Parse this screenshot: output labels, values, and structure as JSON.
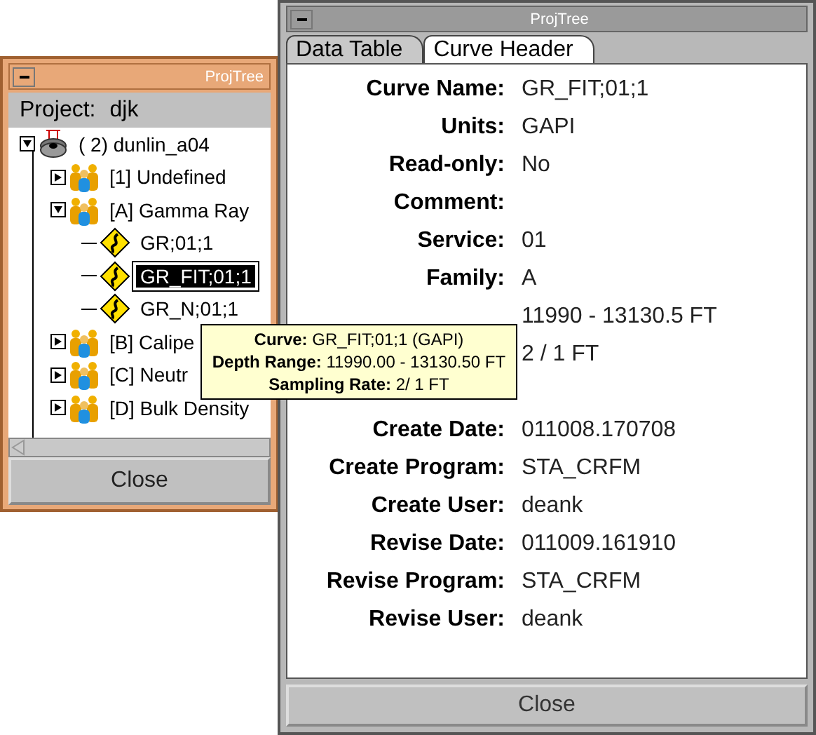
{
  "back_window": {
    "title": "ProjTree",
    "project_label": "Project:",
    "project": "djk",
    "tree": [
      {
        "kind": "well",
        "label": "(   2) dunlin_a04",
        "expanded": true,
        "children": [
          {
            "kind": "group",
            "label": "[1] Undefined",
            "expanded": false
          },
          {
            "kind": "group",
            "label": "[A] Gamma Ray",
            "expanded": true,
            "children": [
              {
                "kind": "curve",
                "label": "GR;01;1",
                "selected": false
              },
              {
                "kind": "curve",
                "label": "GR_FIT;01;1",
                "selected": true
              },
              {
                "kind": "curve",
                "label": "GR_N;01;1",
                "selected": false
              }
            ]
          },
          {
            "kind": "group",
            "label": "[B] Calipe",
            "expanded": false
          },
          {
            "kind": "group",
            "label": "[C] Neutr",
            "expanded": false
          },
          {
            "kind": "group",
            "label": "[D] Bulk Density",
            "expanded": false
          }
        ]
      }
    ],
    "close_button": "Close"
  },
  "front_window": {
    "title": "ProjTree",
    "tabs": [
      {
        "label": "Data Table",
        "selected": false
      },
      {
        "label": "Curve Header",
        "selected": true
      }
    ],
    "fields": [
      {
        "label": "Curve Name:",
        "value": "GR_FIT;01;1"
      },
      {
        "label": "Units:",
        "value": "GAPI"
      },
      {
        "label": "Read-only:",
        "value": "No"
      },
      {
        "label": "Comment:"
      },
      {
        "label": "Service:",
        "value": "01"
      },
      {
        "label": "Family:",
        "value": "A"
      },
      {
        "value": "11990 - 13130.5 FT"
      },
      {
        "value": "2 / 1 FT"
      },
      {
        "label": "Create Date:",
        "value": "011008.170708"
      },
      {
        "label": "Create Program:",
        "value": "STA_CRFM"
      },
      {
        "label": "Create User:",
        "value": "deank"
      },
      {
        "label": "Revise Date:",
        "value": "011009.161910"
      },
      {
        "label": "Revise Program:",
        "value": "STA_CRFM"
      },
      {
        "label": "Revise User:",
        "value": "deank"
      }
    ],
    "close_button": "Close"
  },
  "tooltip": {
    "lines": [
      {
        "label": "Curve:",
        "value": "GR_FIT;01;1 (GAPI)"
      },
      {
        "label": "Depth Range:",
        "value": "11990.00 - 13130.50 FT"
      },
      {
        "label": "Sampling Rate:",
        "value": "2/ 1 FT"
      }
    ]
  }
}
